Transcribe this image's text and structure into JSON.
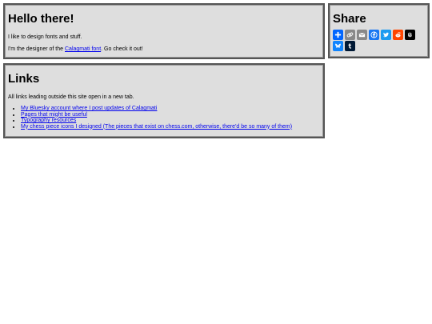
{
  "hello": {
    "title": "Hello there!",
    "line1": "I like to design fonts and stuff.",
    "line2_before": "I'm the designer of the ",
    "line2_link": "Calagmati font",
    "line2_after": ". Go check it out!"
  },
  "share": {
    "title": "Share",
    "icons": [
      {
        "name": "addtoany-plus-icon",
        "color": "#0166ff"
      },
      {
        "name": "copy-link-icon",
        "color": "#888888"
      },
      {
        "name": "email-icon",
        "color": "#888888"
      },
      {
        "name": "facebook-icon",
        "color": "#1877f2"
      },
      {
        "name": "twitter-icon",
        "color": "#1d9bf0"
      },
      {
        "name": "reddit-icon",
        "color": "#ff4500"
      },
      {
        "name": "threads-icon",
        "color": "#000000"
      },
      {
        "name": "bluesky-icon",
        "color": "#1185fe"
      },
      {
        "name": "tumblr-icon",
        "color": "#001935"
      }
    ]
  },
  "links": {
    "title": "Links",
    "intro": "All links leading outside this site open in a new tab.",
    "items": [
      "My Bluesky account where I post updates of Calagmati",
      "Pages that might be useful",
      "Typography resources",
      "My chess piece icons I designed (The pieces that exist on chess.com, otherwise, there'd be so many of them)"
    ]
  }
}
